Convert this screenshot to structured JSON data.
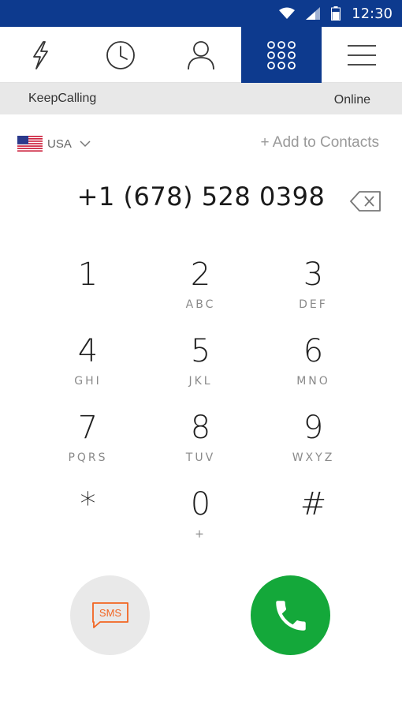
{
  "status_bar": {
    "time": "12:30"
  },
  "nav": {
    "tabs": [
      {
        "name": "flash",
        "icon": "lightning-icon"
      },
      {
        "name": "history",
        "icon": "clock-icon"
      },
      {
        "name": "contacts",
        "icon": "person-icon"
      },
      {
        "name": "keypad",
        "icon": "dialpad-icon",
        "active": true
      },
      {
        "name": "menu",
        "icon": "hamburger-icon"
      }
    ]
  },
  "account": {
    "name": "KeepCalling",
    "status": "Online"
  },
  "country": {
    "label": "USA",
    "flag": "us-flag-icon"
  },
  "add_contacts": "+ Add to Contacts",
  "dialed_number": "+1 (678) 528 0398",
  "keypad": {
    "keys": [
      {
        "digit": "1",
        "letters": ""
      },
      {
        "digit": "2",
        "letters": "ABC"
      },
      {
        "digit": "3",
        "letters": "DEF"
      },
      {
        "digit": "4",
        "letters": "GHI"
      },
      {
        "digit": "5",
        "letters": "JKL"
      },
      {
        "digit": "6",
        "letters": "MNO"
      },
      {
        "digit": "7",
        "letters": "PQRS"
      },
      {
        "digit": "8",
        "letters": "TUV"
      },
      {
        "digit": "9",
        "letters": "WXYZ"
      },
      {
        "digit": "*",
        "letters": ""
      },
      {
        "digit": "0",
        "letters": "+"
      },
      {
        "digit": "#",
        "letters": ""
      }
    ]
  },
  "actions": {
    "sms_label": "SMS"
  },
  "colors": {
    "brand_blue": "#0d3a8e",
    "call_green": "#14a83a",
    "sms_orange": "#f26522"
  }
}
